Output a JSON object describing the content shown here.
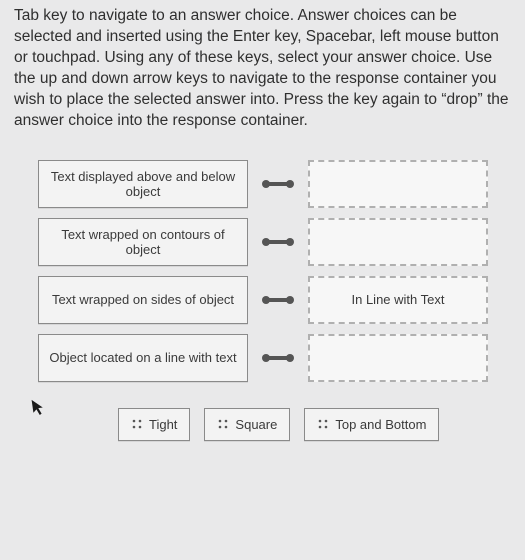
{
  "instructions": "Tab key to navigate to an answer choice. Answer choices can be selected and inserted using the Enter key, Spacebar, left mouse button or touchpad. Using any of these keys, select your answer choice. Use the up and down arrow keys to navigate to the response container you wish to place the selected answer into. Press the key again to “drop” the answer choice into the response container.",
  "rows": [
    {
      "label": "Text displayed above and below object",
      "drop": ""
    },
    {
      "label": "Text wrapped on contours of object",
      "drop": ""
    },
    {
      "label": "Text wrapped on sides of object",
      "drop": "In Line with Text"
    },
    {
      "label": "Object located on a line with text",
      "drop": ""
    }
  ],
  "choices": [
    {
      "label": "Tight"
    },
    {
      "label": "Square"
    },
    {
      "label": "Top and Bottom"
    }
  ]
}
